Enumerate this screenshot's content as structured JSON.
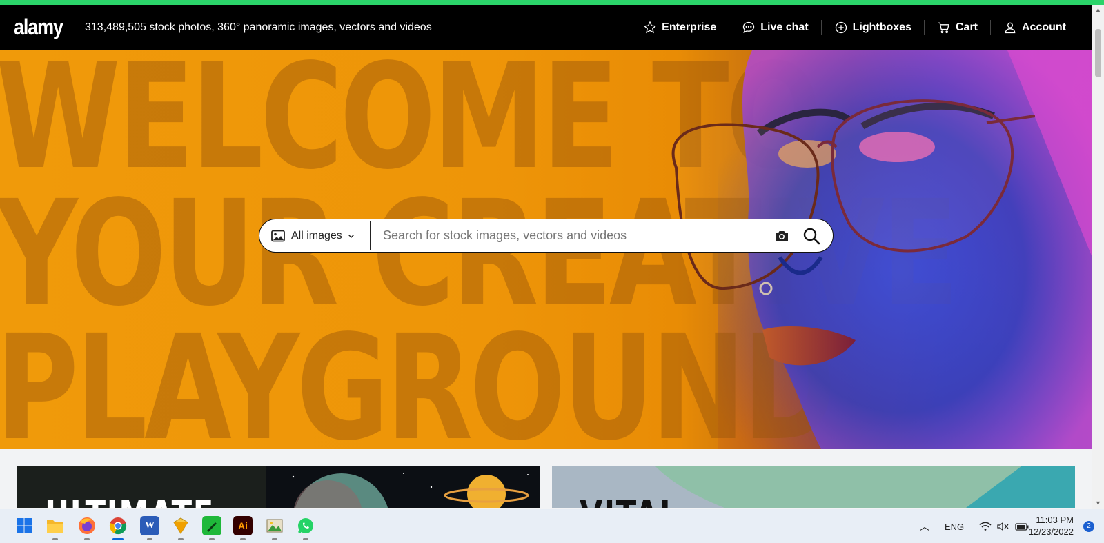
{
  "colors": {
    "top_strip": "#2bd46a",
    "header_bg": "#000000",
    "hero_orange": "#f09a0a"
  },
  "header": {
    "logo": "alamy",
    "tagline": "313,489,505 stock photos, 360° panoramic images, vectors and videos",
    "nav": [
      {
        "label": "Enterprise",
        "icon": "star-icon"
      },
      {
        "label": "Live chat",
        "icon": "chat-bubble-icon"
      },
      {
        "label": "Lightboxes",
        "icon": "plus-circle-icon"
      },
      {
        "label": "Cart",
        "icon": "cart-icon"
      },
      {
        "label": "Account",
        "icon": "user-icon"
      }
    ]
  },
  "hero": {
    "line1": "WELCOME TO",
    "line2": "YOUR CREATIVE",
    "line3": "PLAYGROUND"
  },
  "search": {
    "type_label": "All images",
    "placeholder": "Search for stock images, vectors and videos",
    "value": ""
  },
  "cards": [
    {
      "title": "ULTIMATE"
    },
    {
      "title": "VITAL"
    }
  ],
  "taskbar": {
    "apps": [
      {
        "name": "start-icon"
      },
      {
        "name": "file-explorer-icon"
      },
      {
        "name": "firefox-icon"
      },
      {
        "name": "chrome-icon",
        "active": true
      },
      {
        "name": "word-icon"
      },
      {
        "name": "sketch-app-icon"
      },
      {
        "name": "green-pen-app-icon"
      },
      {
        "name": "illustrator-icon",
        "label": "Ai"
      },
      {
        "name": "image-viewer-icon"
      },
      {
        "name": "whatsapp-icon"
      }
    ],
    "language": "ENG",
    "time": "11:03 PM",
    "date": "12/23/2022",
    "notifications": "2"
  }
}
